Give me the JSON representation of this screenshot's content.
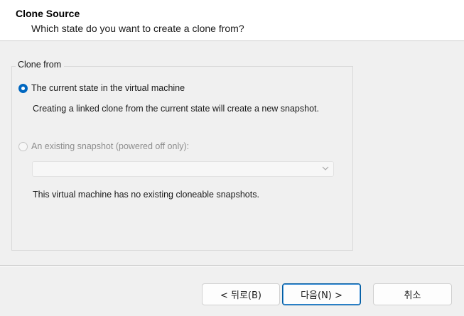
{
  "header": {
    "title": "Clone Source",
    "subtitle": "Which state do you want to create a clone from?"
  },
  "clone_from": {
    "legend": "Clone from",
    "option_current": {
      "label": "The current state in the virtual machine",
      "checked": true,
      "description": "Creating a linked clone from the current state will create a new snapshot."
    },
    "option_snapshot": {
      "label": "An existing snapshot (powered off only):",
      "checked": false,
      "disabled": true,
      "selected_value": "",
      "note": "This virtual machine has no existing cloneable snapshots."
    }
  },
  "buttons": {
    "back": "< 뒤로(B)",
    "next": "다음(N) >",
    "cancel": "취소"
  },
  "colors": {
    "accent": "#0067c0",
    "header_background": "#ffffff",
    "dialog_background": "#f0f0f0"
  }
}
